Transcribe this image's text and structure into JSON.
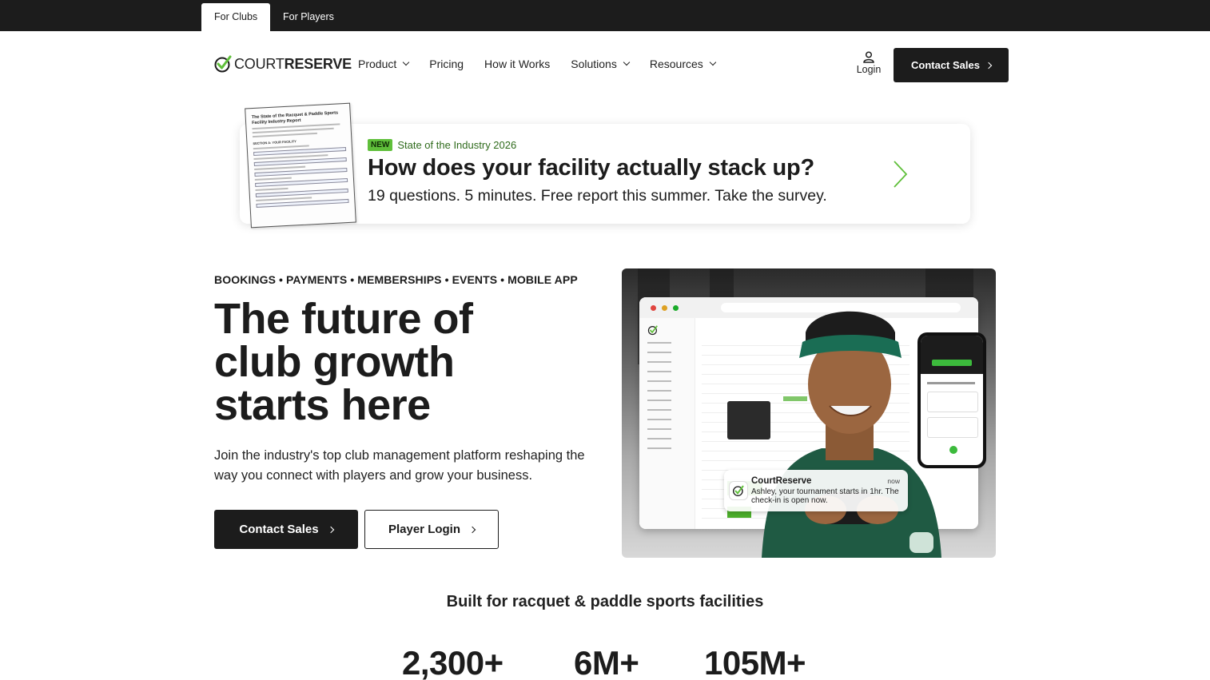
{
  "topbar": {
    "tabs": [
      {
        "label": "For Clubs",
        "active": true
      },
      {
        "label": "For Players",
        "active": false
      }
    ]
  },
  "header": {
    "logo": {
      "light": "COURT",
      "bold": "RESERVE",
      "icon": "checkmark-logo-icon"
    },
    "nav": [
      {
        "label": "Product",
        "has_dropdown": true
      },
      {
        "label": "Pricing",
        "has_dropdown": false
      },
      {
        "label": "How it Works",
        "has_dropdown": false
      },
      {
        "label": "Solutions",
        "has_dropdown": true
      },
      {
        "label": "Resources",
        "has_dropdown": true
      }
    ],
    "login_label": "Login",
    "cta_label": "Contact Sales"
  },
  "banner": {
    "badge": "NEW",
    "label": "State of the Industry 2026",
    "title": "How does your facility actually stack up?",
    "subtitle": "19 questions. 5 minutes. Free report this summer. Take the survey.",
    "doc_title": "The State of the Racquet & Paddle Sports Facility Industry Report",
    "doc_section": "SECTION A: YOUR FACILITY"
  },
  "hero": {
    "eyebrow": "BOOKINGS • PAYMENTS • MEMBERSHIPS • EVENTS • MOBILE APP",
    "headline_lines": [
      "The future of",
      "club growth",
      "starts here"
    ],
    "subtext": "Join the industry's top club management platform reshaping the way you connect with players and grow your business.",
    "primary_cta": "Contact Sales",
    "secondary_cta": "Player Login",
    "notification": {
      "app": "CourtReserve",
      "time": "now",
      "message": "Ashley, your tournament starts in 1hr. The check-in is open now."
    }
  },
  "stats": {
    "heading": "Built for racquet & paddle sports facilities",
    "values": [
      "2,300+",
      "6M+",
      "105M+"
    ]
  },
  "colors": {
    "dark": "#1c1c1c",
    "accent_green": "#5fbf3a",
    "label_green": "#2f6b1c"
  }
}
